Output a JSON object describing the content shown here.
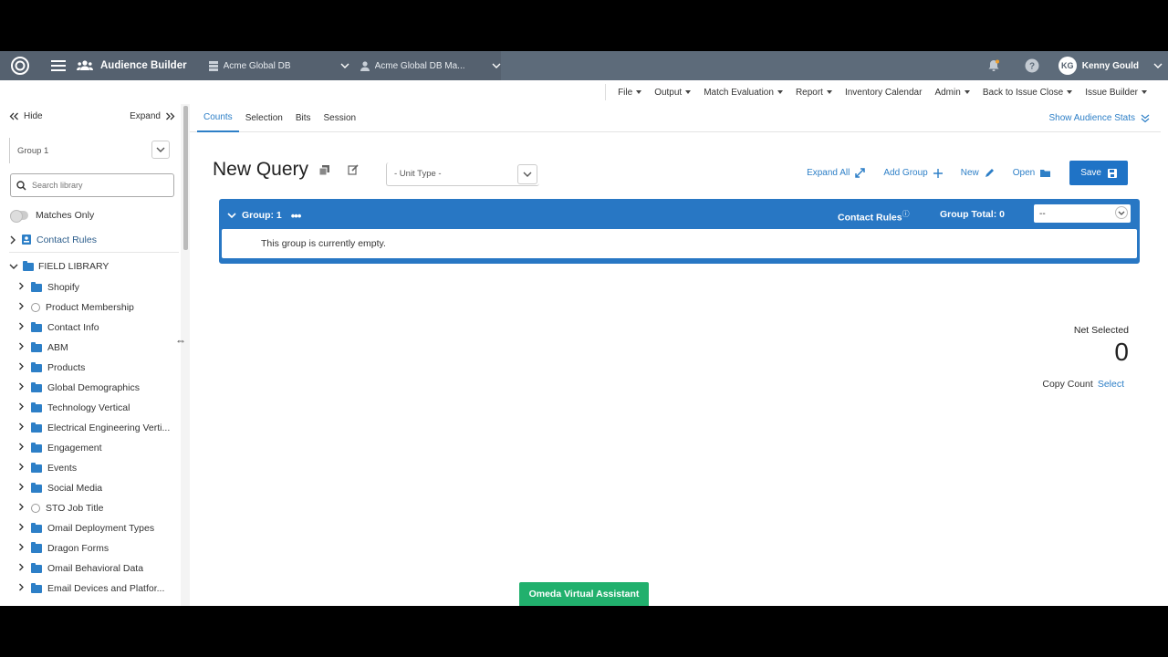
{
  "navbar": {
    "app_title": "Audience Builder",
    "database": "Acme Global DB",
    "manager": "Acme Global DB Ma...",
    "user": {
      "initials": "KG",
      "name": "Kenny Gould"
    }
  },
  "menubar": {
    "items": [
      "File",
      "Output",
      "Match Evaluation",
      "Report",
      "Inventory Calendar",
      "Admin",
      "Back to Issue Close",
      "Issue Builder"
    ]
  },
  "sidebar": {
    "hide_label": "Hide",
    "expand_label": "Expand",
    "group_select": "Group 1",
    "search_placeholder": "Search library",
    "matches_only": "Matches Only",
    "contact_rules": "Contact Rules",
    "field_library": "FIELD LIBRARY",
    "items": [
      {
        "label": "Shopify",
        "icon": "folder-icon"
      },
      {
        "label": "Product Membership",
        "icon": "circle-icon"
      },
      {
        "label": "Contact Info",
        "icon": "folder-icon"
      },
      {
        "label": "ABM",
        "icon": "folder-icon"
      },
      {
        "label": "Products",
        "icon": "folder-icon"
      },
      {
        "label": "Global Demographics",
        "icon": "folder-icon"
      },
      {
        "label": "Technology Vertical",
        "icon": "folder-icon"
      },
      {
        "label": "Electrical Engineering Verti...",
        "icon": "folder-icon"
      },
      {
        "label": "Engagement",
        "icon": "folder-icon"
      },
      {
        "label": "Events",
        "icon": "folder-icon"
      },
      {
        "label": "Social Media",
        "icon": "folder-icon"
      },
      {
        "label": "STO Job Title",
        "icon": "circle-icon"
      },
      {
        "label": "Omail Deployment Types",
        "icon": "folder-icon"
      },
      {
        "label": "Dragon Forms",
        "icon": "grid-icon"
      },
      {
        "label": "Omail Behavioral Data",
        "icon": "folder-icon"
      },
      {
        "label": "Email Devices and Platfor...",
        "icon": "folder-icon"
      }
    ]
  },
  "main": {
    "tabs": [
      "Counts",
      "Selection",
      "Bits",
      "Session"
    ],
    "show_stats": "Show Audience Stats",
    "title": "New Query",
    "unit_type_placeholder": "- Unit Type -",
    "actions": {
      "expand_all": "Expand All",
      "add_group": "Add Group",
      "new": "New",
      "open": "Open",
      "save": "Save"
    },
    "group": {
      "title": "Group: 1",
      "contact_rules": "Contact Rules",
      "group_total": "Group Total: 0",
      "select_value": "--",
      "empty_text": "This group is currently empty."
    },
    "net_selected_label": "Net Selected",
    "net_selected_value": "0",
    "copy_count_label": "Copy Count",
    "copy_count_link": "Select"
  },
  "assistant_label": "Omeda Virtual Assistant",
  "colors": {
    "navbar": "#55616f",
    "accent": "#2877c4",
    "assistant": "#21b06d"
  }
}
